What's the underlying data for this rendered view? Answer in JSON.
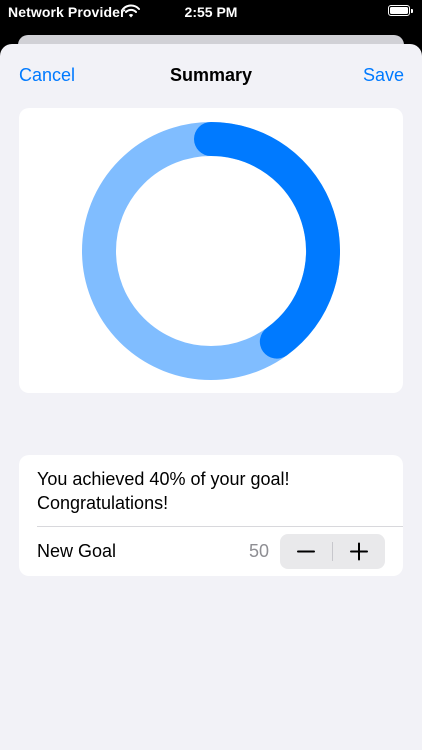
{
  "status_bar": {
    "carrier": "Network Provider",
    "time": "2:55 PM",
    "wifi_icon": "wifi-icon",
    "battery_icon": "battery-icon"
  },
  "nav": {
    "cancel_label": "Cancel",
    "title": "Summary",
    "save_label": "Save"
  },
  "progress_ring": {
    "progress_fraction": 0.4,
    "progress_color": "#007aff",
    "track_color": "#80bdff"
  },
  "summary": {
    "message": "You achieved 40% of your goal! Congratulations!",
    "goal_label": "New Goal",
    "goal_value": "50",
    "decrement_icon": "minus-icon",
    "increment_icon": "plus-icon"
  },
  "colors": {
    "accent": "#007aff",
    "background": "#f2f2f7",
    "card": "#ffffff",
    "secondary_text": "#8e8e93"
  }
}
